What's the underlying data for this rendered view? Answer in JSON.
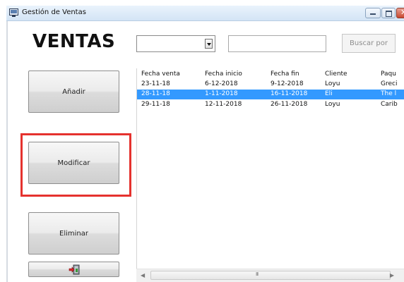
{
  "window": {
    "title": "Gestión de Ventas"
  },
  "heading": "VENTAS",
  "filter": {
    "selected": "",
    "search_value": "",
    "search_button_label": "Buscar por"
  },
  "actions": {
    "add_label": "Añadir",
    "modify_label": "Modificar",
    "delete_label": "Eliminar",
    "exit_icon": "exit-door-icon"
  },
  "table": {
    "columns": [
      "Fecha venta",
      "Fecha inicio",
      "Fecha fin",
      "Cliente",
      "Paqu"
    ],
    "rows": [
      [
        "23-11-18",
        "6-12-2018",
        "9-12-2018",
        "Loyu",
        "Greci"
      ],
      [
        "28-11-18",
        "1-11-2018",
        "16-11-2018",
        "Eli",
        "The l"
      ],
      [
        "29-11-18",
        "12-11-2018",
        "26-11-2018",
        "Loyu",
        "Carib"
      ]
    ],
    "selected_row": 1
  },
  "scrollbar": {
    "grip": "III"
  },
  "colors": {
    "selection": "#3399ff",
    "highlight_border": "#e5322e",
    "title_bar": "#d3e4f5"
  }
}
